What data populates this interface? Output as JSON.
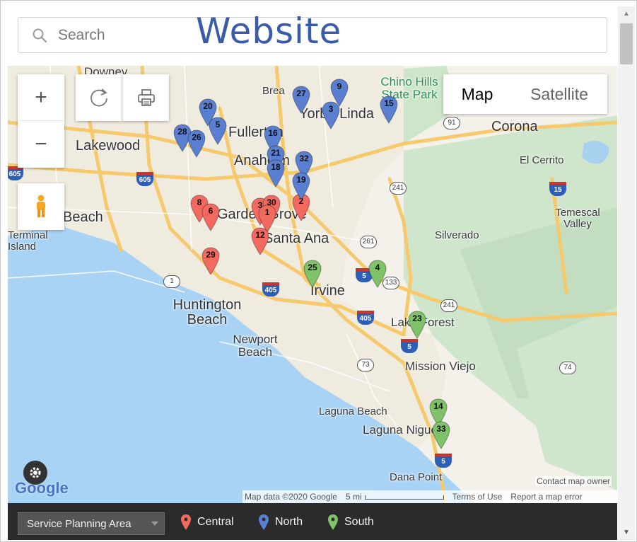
{
  "header": {
    "search_placeholder": "Search",
    "overlay_label": "Website"
  },
  "map": {
    "type_control": {
      "map_label": "Map",
      "satellite_label": "Satellite"
    },
    "controls": {
      "zoom_in": "+",
      "zoom_out": "−"
    },
    "places": [
      "Downey",
      "Brea",
      "Chino Hills State Park",
      "Yorba Linda",
      "Fullerton",
      "Corona",
      "Lakewood",
      "Anaheim",
      "El Cerrito",
      "Beach",
      "Garden Grove",
      "Temescal Valley",
      "Silverado",
      "Santa Ana",
      "Terminal Island",
      "Huntington Beach",
      "Irvine",
      "Newport Beach",
      "Lake Forest",
      "Mission Viejo",
      "Laguna Beach",
      "Laguna Niguel",
      "Dana Point"
    ],
    "highway_shields": [
      "605",
      "605",
      "91",
      "241",
      "15",
      "261",
      "5",
      "133",
      "1",
      "405",
      "241",
      "405",
      "5",
      "73",
      "74",
      "5"
    ],
    "markers": {
      "central": [
        "8",
        "6",
        "3",
        "30",
        "1",
        "12",
        "2",
        "29"
      ],
      "north": [
        "20",
        "5",
        "28",
        "26",
        "16",
        "21",
        "18",
        "32",
        "19",
        "27",
        "9",
        "3",
        "15"
      ],
      "south": [
        "25",
        "4",
        "23",
        "14",
        "33"
      ]
    },
    "attribution": {
      "contact": "Contact map owner",
      "map_data": "Map data ©2020 Google",
      "scale": "5 mi",
      "terms": "Terms of Use",
      "report": "Report a map error",
      "logo": "Google"
    }
  },
  "legend": {
    "filter_label": "Service Planning Area",
    "items": [
      {
        "label": "Central",
        "color": "#f26a5f"
      },
      {
        "label": "North",
        "color": "#5b7fd0"
      },
      {
        "label": "South",
        "color": "#7fc26a"
      }
    ]
  }
}
